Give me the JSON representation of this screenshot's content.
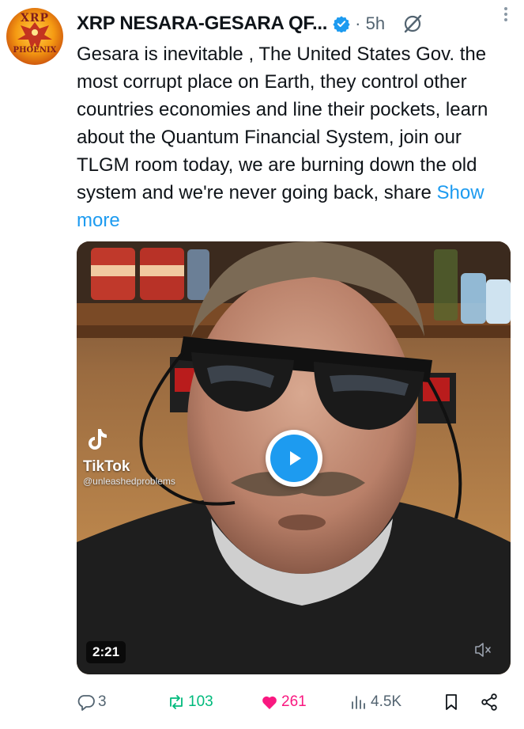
{
  "post": {
    "author": "XRP NESARA-GESARA QF...",
    "time": "· 5h",
    "text": "Gesara is inevitable , The United States Gov. the most corrupt place on Earth, they control other countries economies and line their pockets, learn about the Quantum Financial System, join our TLGM room today, we are burning down the old system and we're never going back, share ",
    "show_more": "Show more"
  },
  "avatar": {
    "top_text": "XRP",
    "bottom_text": "PHOENIX"
  },
  "video": {
    "watermark_brand": "TikTok",
    "watermark_handle": "@unleashedproblems",
    "duration": "2:21",
    "icons": {
      "play": "play-icon",
      "mute": "muted-speaker-icon"
    }
  },
  "actions": {
    "replies": "3",
    "reposts": "103",
    "likes": "261",
    "views": "4.5K"
  },
  "colors": {
    "accent": "#1d9bf0",
    "repost": "#00ba7c",
    "like": "#f91880",
    "muted": "#536471"
  }
}
